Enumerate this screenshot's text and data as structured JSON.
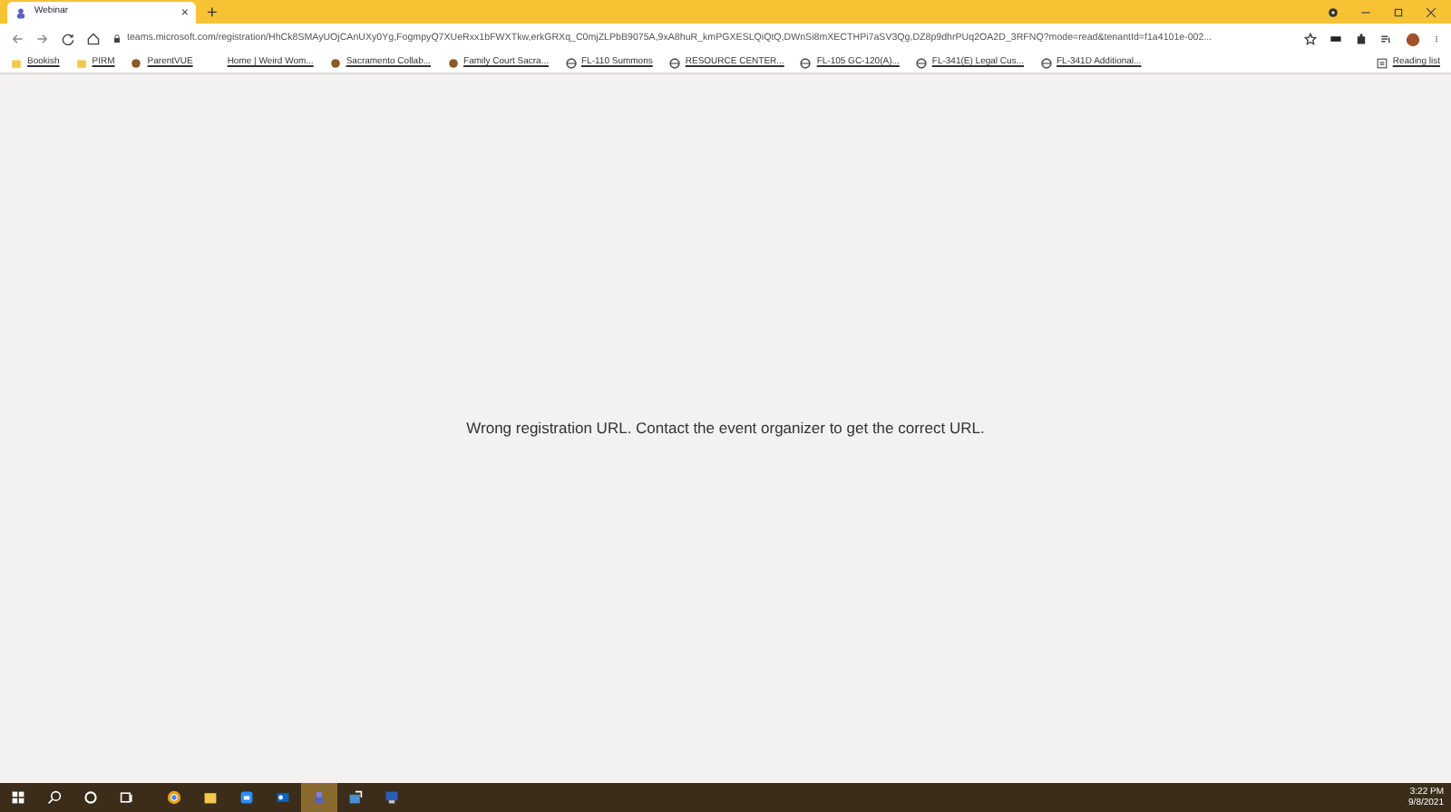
{
  "browser": {
    "tab": {
      "title": "Webinar",
      "close": "×"
    },
    "new_tab": "+",
    "address": "teams.microsoft.com/registration/HhCk8SMAyUOjCAnUXy0Yg,FogmpyQ7XUeRxx1bFWXTkw,erkGRXq_C0mjZLPbB9075A,9xA8huR_kmPGXESLQiQtQ,DWnSi8mXECTHPi7aSV3Qg,DZ8p9dhrPUq2OA2D_3RFNQ?mode=read&tenantId=f1a4101e-002...",
    "bookmarks": [
      {
        "kind": "folder",
        "label": "Bookish"
      },
      {
        "kind": "folder",
        "label": "PIRM"
      },
      {
        "kind": "site",
        "label": "ParentVUE"
      },
      {
        "kind": "plain",
        "label": "Home | Weird Wom..."
      },
      {
        "kind": "site",
        "label": "Sacramento Collab..."
      },
      {
        "kind": "site",
        "label": "Family Court Sacra..."
      },
      {
        "kind": "globe",
        "label": "FL-110 Summons"
      },
      {
        "kind": "globe",
        "label": "RESOURCE CENTER..."
      },
      {
        "kind": "globe",
        "label": "FL-105 GC-120(A)..."
      },
      {
        "kind": "globe",
        "label": "FL-341(E) Legal Cus..."
      },
      {
        "kind": "globe",
        "label": "FL-341D Additional..."
      }
    ],
    "reading_list": "Reading list"
  },
  "message": "Wrong registration URL. Contact the event organizer to get the correct URL.",
  "taskbar": {
    "apps": [
      {
        "kind": "start",
        "selected": false
      },
      {
        "kind": "search",
        "selected": false
      },
      {
        "kind": "circle",
        "selected": false
      },
      {
        "kind": "taskview",
        "selected": false
      },
      {
        "kind": "chrome",
        "selected": false
      },
      {
        "kind": "folder",
        "selected": false
      },
      {
        "kind": "camera",
        "selected": false
      },
      {
        "kind": "mail",
        "selected": false
      },
      {
        "kind": "teams",
        "selected": true
      },
      {
        "kind": "remote",
        "selected": false
      },
      {
        "kind": "monitor",
        "selected": false
      }
    ],
    "time": "3:22 PM",
    "date": "9/8/2021"
  }
}
